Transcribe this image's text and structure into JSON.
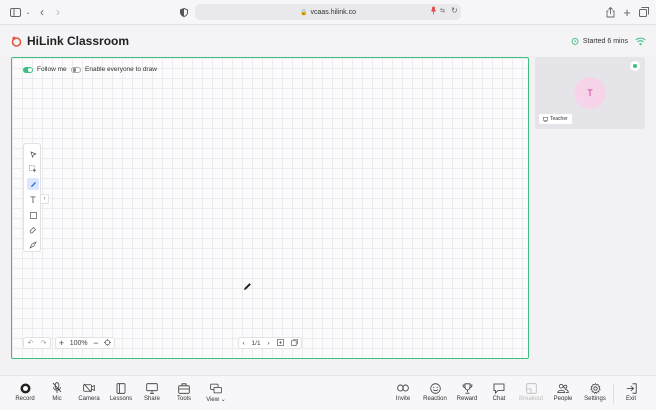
{
  "browser": {
    "url": "vcaas.hilink.co"
  },
  "header": {
    "title": "HiLink Classroom",
    "started": "Started 6 mins"
  },
  "board": {
    "follow_me": "Follow me",
    "follow_me_on": true,
    "enable_draw": "Enable everyone to draw",
    "enable_draw_on": false,
    "zoom": "100%",
    "page": "1/1"
  },
  "video": {
    "avatar_initial": "T",
    "role": "Teacher"
  },
  "bottom": {
    "items": [
      {
        "label": "Record",
        "icon": "record-icon"
      },
      {
        "label": "Mic",
        "icon": "mic-off-icon"
      },
      {
        "label": "Camera",
        "icon": "camera-off-icon"
      },
      {
        "label": "Lessons",
        "icon": "book-icon"
      },
      {
        "label": "Share",
        "icon": "monitor-icon"
      },
      {
        "label": "Tools",
        "icon": "toolbox-icon"
      },
      {
        "label": "View",
        "icon": "view-icon"
      },
      {
        "label": "Invite",
        "icon": "link-icon"
      },
      {
        "label": "Reaction",
        "icon": "smile-icon"
      },
      {
        "label": "Reward",
        "icon": "trophy-icon"
      },
      {
        "label": "Chat",
        "icon": "chat-icon"
      },
      {
        "label": "Breakout",
        "icon": "breakout-icon"
      },
      {
        "label": "People",
        "icon": "people-icon"
      },
      {
        "label": "Settings",
        "icon": "gear-icon"
      },
      {
        "label": "Exit",
        "icon": "exit-icon"
      }
    ]
  },
  "colors": {
    "accent": "#3fbf7f",
    "tool_active": "#2e6ee6",
    "avatar_bg": "#f8d4ea"
  }
}
